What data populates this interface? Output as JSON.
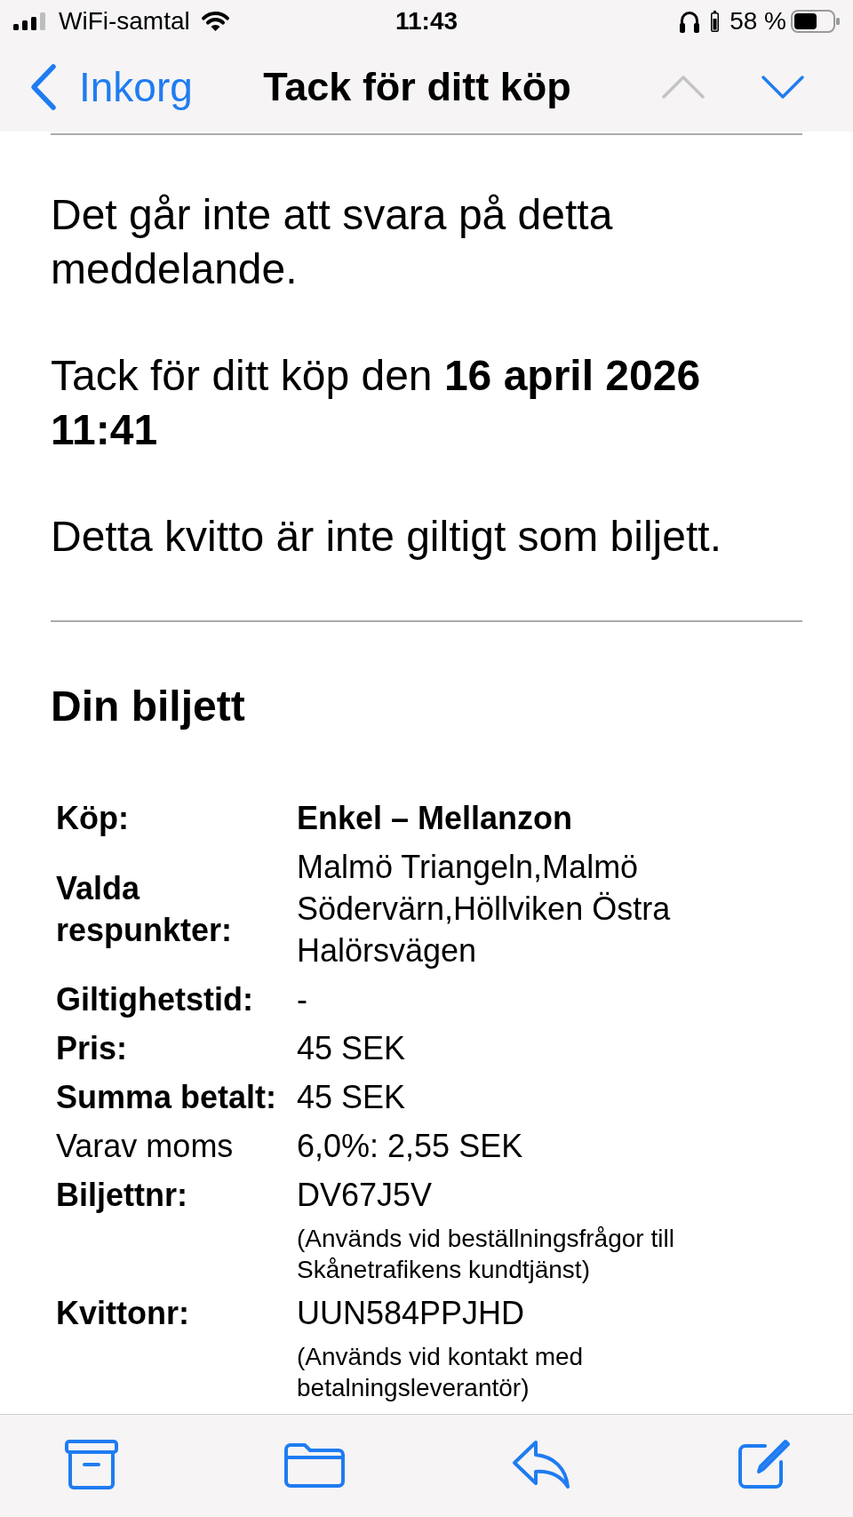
{
  "status_bar": {
    "carrier": "WiFi-samtal",
    "time": "11:43",
    "battery": "58 %"
  },
  "nav_bar": {
    "back": "Inkorg",
    "title": "Tack för ditt köp",
    "arrows": [
      {
        "kind": "up",
        "disabled": true
      },
      {
        "kind": "down",
        "disabled": false
      }
    ]
  },
  "message": {
    "paragraphs": [
      "Det går inte att svara på detta meddelande.",
      "Tack för ditt köp den **16 april 2026 11:41**",
      "Detta kvitto är inte giltigt som biljett."
    ],
    "heading": "Din biljett",
    "details": [
      {
        "label": "Köp:",
        "value": "Enkel – Mellanzon",
        "label_bold": true,
        "value_bold": true
      },
      {
        "label": "Valda respunkter:",
        "value": "Malmö Triangeln,Malmö Södervärn,Höllviken Östra Halörsvägen",
        "label_bold": true,
        "value_bold": false
      },
      {
        "label": "Giltighetstid:",
        "value": "-",
        "label_bold": true,
        "value_bold": false
      },
      {
        "label": "Pris:",
        "value": "45 SEK",
        "label_bold": true,
        "value_bold": false
      },
      {
        "label": "Summa betalt:",
        "value": "45 SEK",
        "label_bold": true,
        "value_bold": false
      },
      {
        "label": "Varav moms",
        "value": "6,0%: 2,55 SEK",
        "label_bold": false,
        "value_bold": false
      },
      {
        "label": "Biljettnr:",
        "value": "DV67J5V",
        "note": "(Används vid beställningsfrågor till Skånetrafikens kundtjänst)",
        "label_bold": true,
        "value_bold": false
      },
      {
        "label": "Kvittonr:",
        "value": "UUN584PPJHD",
        "note": "(Används vid kontakt med betalningsleverantör)",
        "label_bold": true,
        "value_bold": false
      }
    ]
  }
}
